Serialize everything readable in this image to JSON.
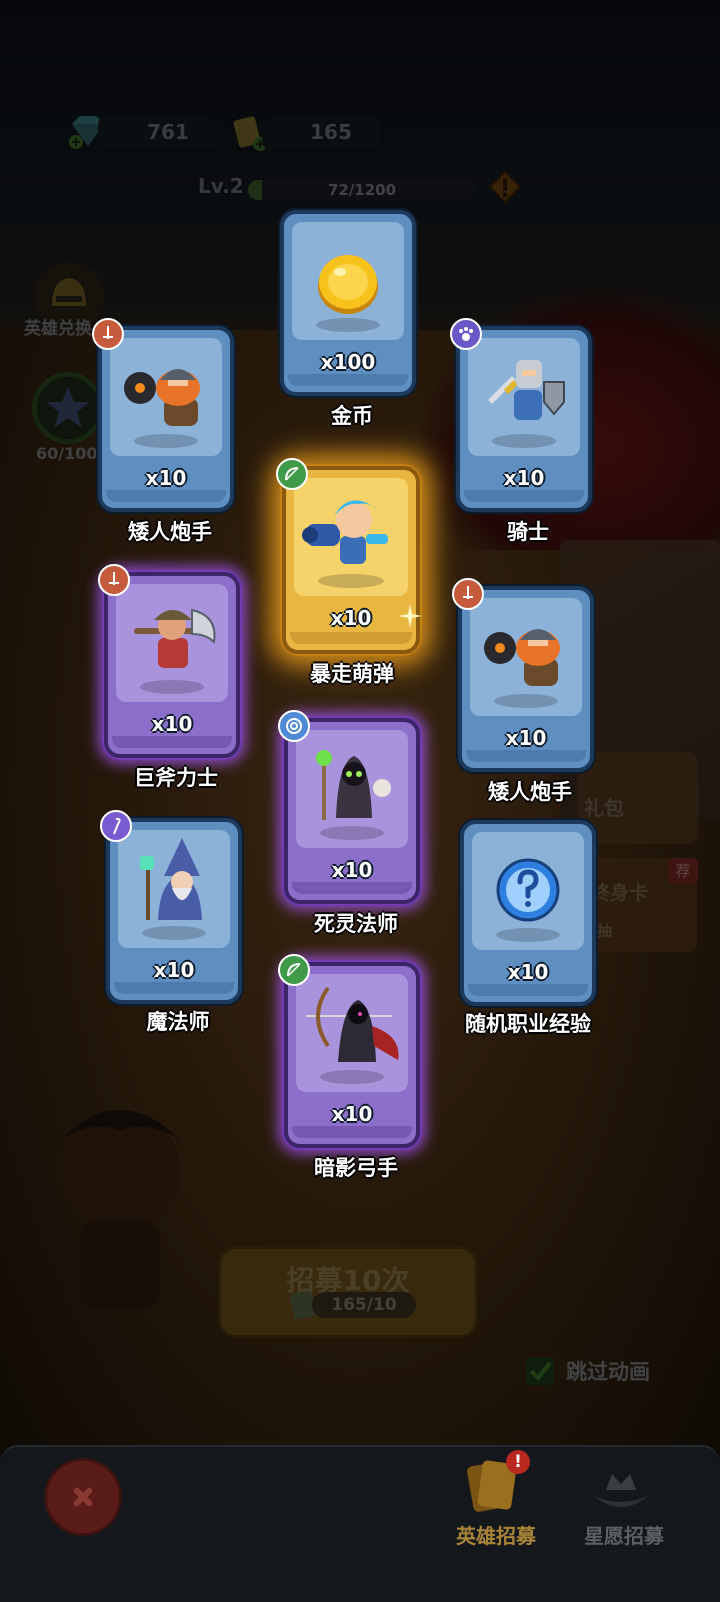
{
  "header": {
    "gems": "761",
    "tickets": "165",
    "level": "Lv.2",
    "xp_text": "72/1200",
    "xp_progress": 0.06
  },
  "side_menu": {
    "hero_exchange_label": "英雄兑换",
    "star_progress": "60/100"
  },
  "banners": {
    "gift": "礼包",
    "lifetime_card": "终身卡",
    "lifetime_sub": "抽",
    "new_tag": "荐"
  },
  "rewards": [
    {
      "name": "金币",
      "qty": "x100",
      "rarity": "blue",
      "icon": "gold-coin-icon",
      "class": ""
    },
    {
      "name": "矮人炮手",
      "qty": "x10",
      "rarity": "blue",
      "icon": "dwarf-gunner-portrait",
      "class": "warrior"
    },
    {
      "name": "骑士",
      "qty": "x10",
      "rarity": "blue",
      "icon": "knight-portrait",
      "class": "tank"
    },
    {
      "name": "暴走萌弹",
      "qty": "x10",
      "rarity": "gold",
      "icon": "cannon-girl-portrait",
      "class": "archer"
    },
    {
      "name": "巨斧力士",
      "qty": "x10",
      "rarity": "purple",
      "icon": "axe-warrior-portrait",
      "class": "warrior"
    },
    {
      "name": "矮人炮手",
      "qty": "x10",
      "rarity": "blue",
      "icon": "dwarf-gunner-portrait",
      "class": "warrior"
    },
    {
      "name": "死灵法师",
      "qty": "x10",
      "rarity": "purple",
      "icon": "necromancer-portrait",
      "class": "mage"
    },
    {
      "name": "魔法师",
      "qty": "x10",
      "rarity": "blue",
      "icon": "wizard-portrait",
      "class": "support"
    },
    {
      "name": "随机职业经验",
      "qty": "x10",
      "rarity": "blue",
      "icon": "question-orb-icon",
      "class": ""
    },
    {
      "name": "暗影弓手",
      "qty": "x10",
      "rarity": "purple",
      "icon": "shadow-archer-portrait",
      "class": "archer"
    }
  ],
  "recruit": {
    "button_label": "招募10次",
    "cost": "165/10"
  },
  "skip_animation": {
    "label": "跳过动画",
    "checked": true
  },
  "bottom_nav": {
    "hero_recruit": "英雄招募",
    "wish_recruit": "星愿招募",
    "hero_recruit_badge": "!"
  },
  "colors": {
    "blue_card": "#5f8ec0",
    "purple_card": "#8c6fca",
    "gold_card": "#e9b641",
    "active_nav": "#a88437",
    "inactive_nav": "#5c5f64"
  }
}
